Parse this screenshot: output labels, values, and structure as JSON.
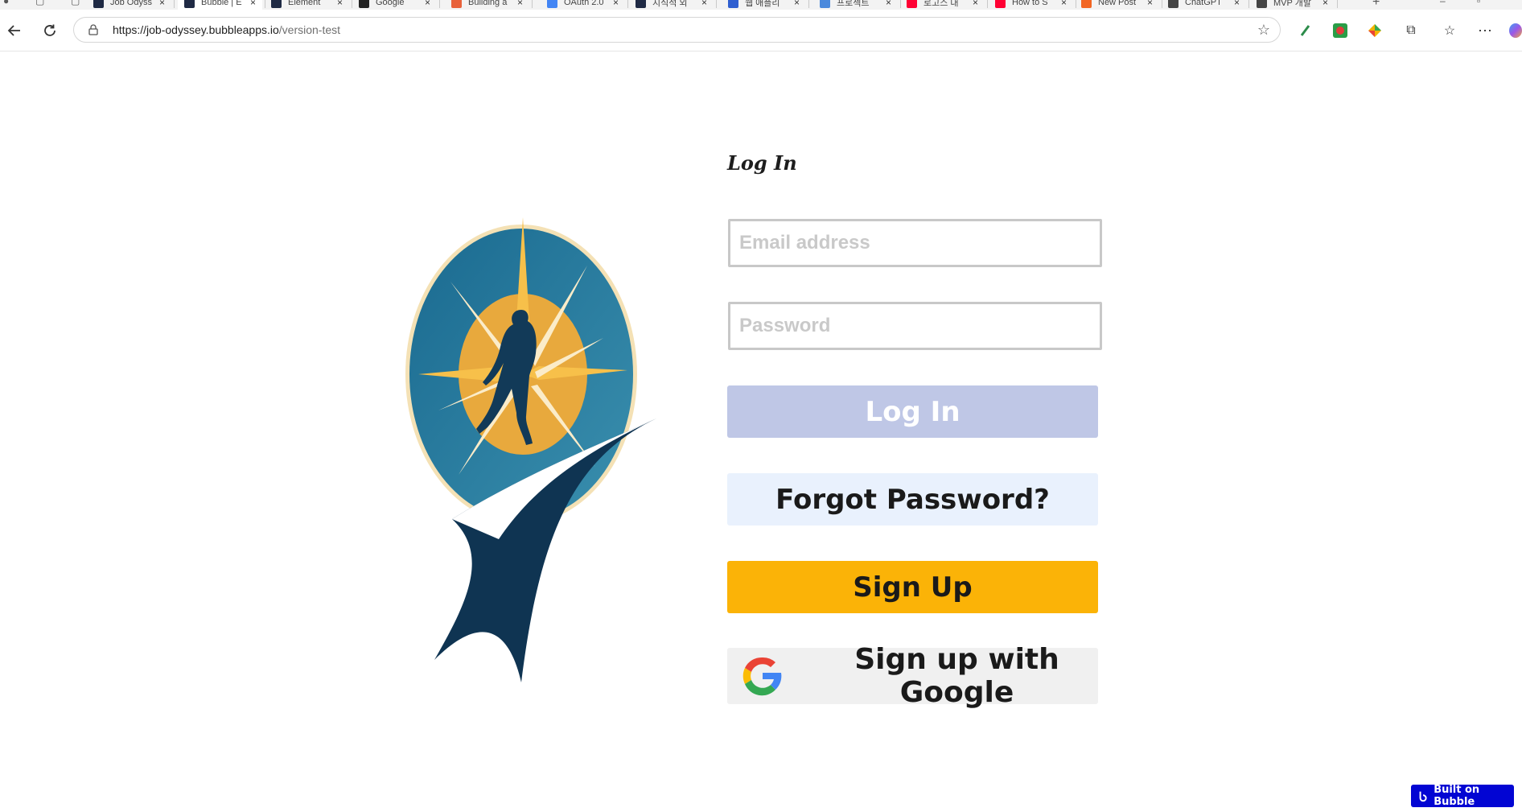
{
  "browser": {
    "tabs": [
      {
        "title": "Job Odyssey",
        "favicon_color": "#1f2a44"
      },
      {
        "title": "Bubble | E",
        "favicon_color": "#1f2a44"
      },
      {
        "title": "Element",
        "favicon_color": "#1f2a44"
      },
      {
        "title": "Google",
        "favicon_color": "#222222"
      },
      {
        "title": "Building a",
        "favicon_color": "#e8623b"
      },
      {
        "title": "OAuth 2.0",
        "favicon_color": "#4285f4"
      },
      {
        "title": "지식적 외",
        "favicon_color": "#1f2a44"
      },
      {
        "title": "웹 애플리",
        "favicon_color": "#2f5fd0"
      },
      {
        "title": "프로젝트",
        "favicon_color": "#4a89dc"
      },
      {
        "title": "로고스 대",
        "favicon_color": "#ff0033"
      },
      {
        "title": "How to S",
        "favicon_color": "#ff0033"
      },
      {
        "title": "New Post",
        "favicon_color": "#f26522"
      },
      {
        "title": "ChatGPT",
        "favicon_color": "#444444"
      },
      {
        "title": "MVP 개발",
        "favicon_color": "#444444"
      }
    ],
    "url_host": "https://job-odyssey.bubbleapps.io",
    "url_path": "/version-test"
  },
  "login": {
    "title": "Log In",
    "email_placeholder": "Email address",
    "password_placeholder": "Password",
    "login_button": "Log In",
    "forgot_button": "Forgot Password?",
    "signup_button": "Sign Up",
    "google_button": "Sign up with Google"
  },
  "badge": {
    "label": "Built on Bubble"
  },
  "colors": {
    "login_button_bg": "#bfc7e6",
    "forgot_button_bg": "#e9f1fd",
    "signup_button_bg": "#fbb307",
    "badge_bg": "#0205d3"
  }
}
